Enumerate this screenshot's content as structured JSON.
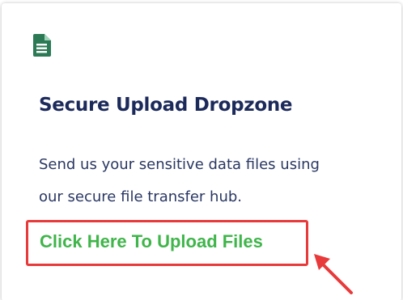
{
  "card": {
    "title": "Secure Upload Dropzone",
    "description_lines": [
      "Send us your sensitive data files using",
      "our secure file transfer hub."
    ],
    "upload_link_label": "Click Here To Upload Files",
    "icon": "document-icon",
    "annotation_icon": "red-arrow-icon"
  },
  "colors": {
    "title": "#1c2a5b",
    "text": "#2a3763",
    "link": "#3fb54a",
    "icon": "#2c7a55",
    "highlight": "#e83a3a"
  }
}
